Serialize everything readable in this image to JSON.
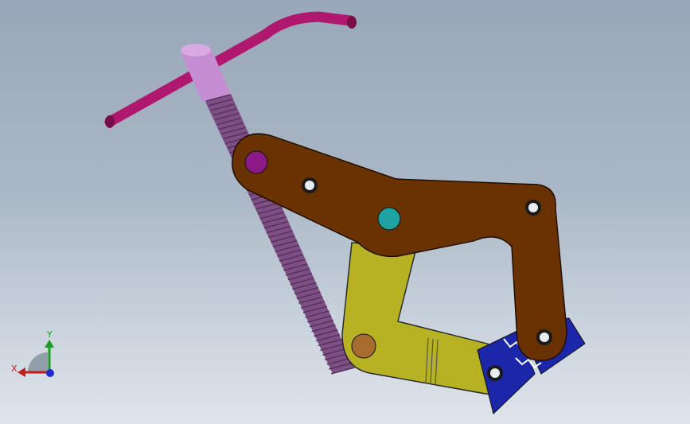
{
  "viewport": {
    "background_top": "#98a7b9",
    "background_bottom": "#dfe4ea"
  },
  "model": {
    "parts": [
      {
        "name": "t-handle",
        "color": "#b0176e"
      },
      {
        "name": "handle-collar",
        "color": "#c58ed2"
      },
      {
        "name": "lead-screw",
        "color": "#7e4f84"
      },
      {
        "name": "upper-arm",
        "color": "#6a3200"
      },
      {
        "name": "lower-jaw",
        "color": "#b6b223"
      },
      {
        "name": "jaw-pads",
        "color": "#1c26a8"
      }
    ],
    "pins": [
      {
        "name": "pivot-magenta",
        "color": "#8c1a86"
      },
      {
        "name": "pivot-teal",
        "color": "#1ea2a2"
      },
      {
        "name": "pivot-bronze",
        "color": "#a86d2e"
      }
    ]
  },
  "triad": {
    "x_label": "X",
    "y_label": "Y",
    "x_color": "#c21d1d",
    "y_color": "#1c9b22",
    "z_color": "#1f2bd0"
  }
}
